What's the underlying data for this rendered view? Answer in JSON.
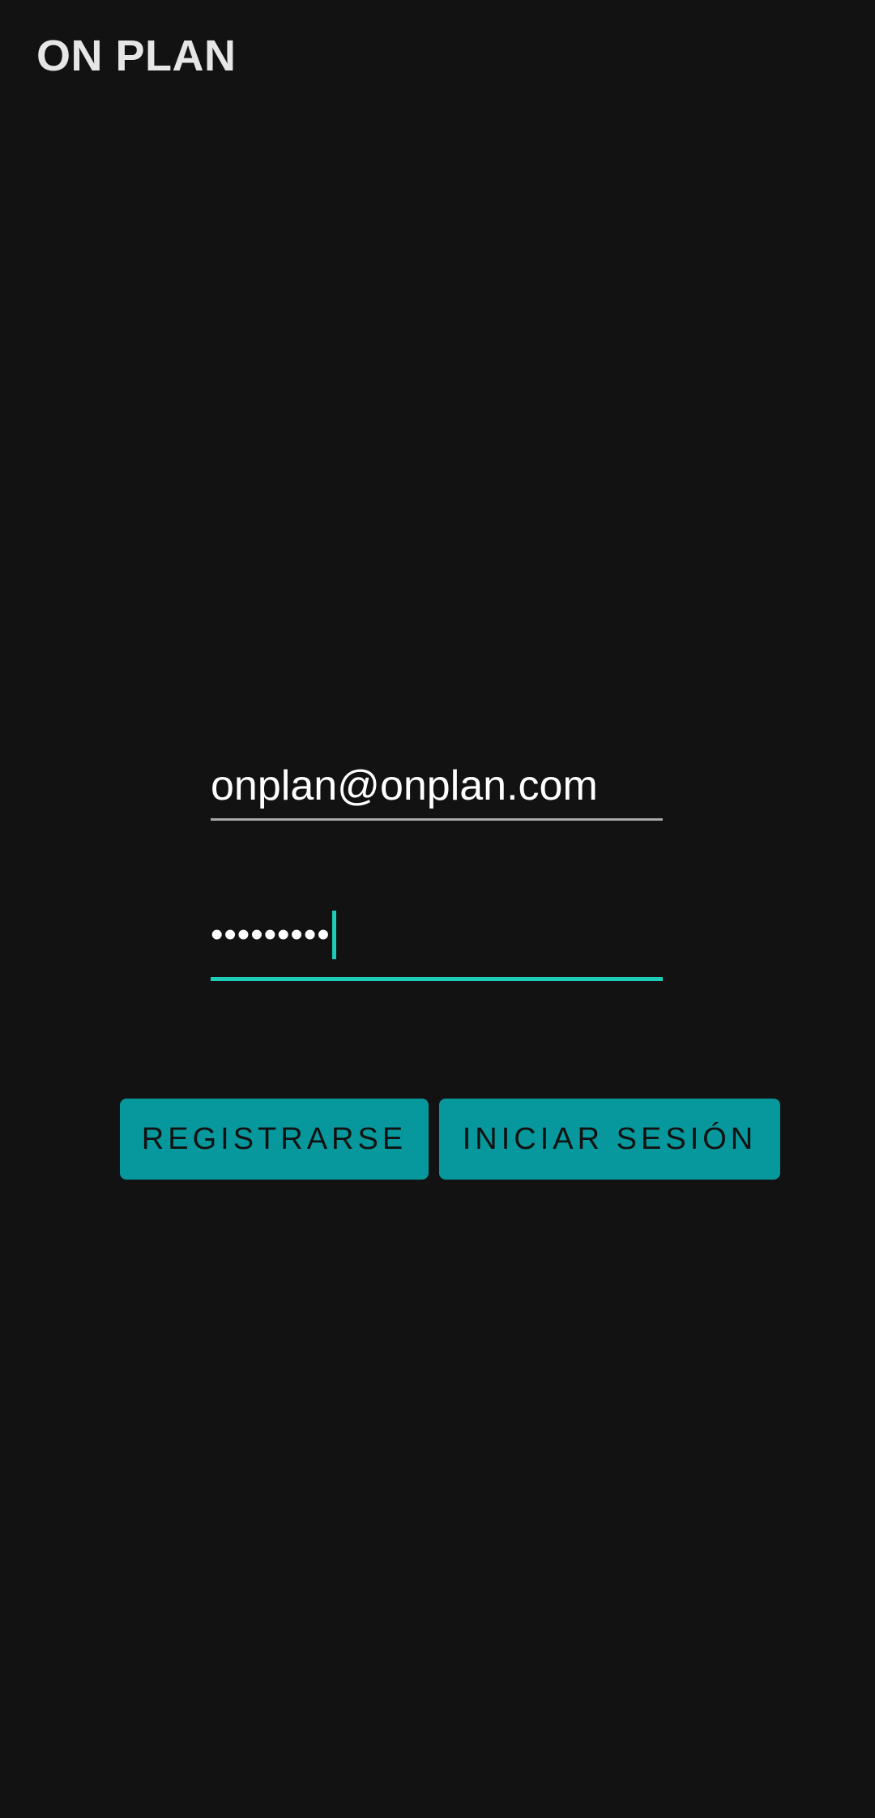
{
  "app_bar": {
    "title": "ON PLAN"
  },
  "login_form": {
    "email": {
      "value": "onplan@onplan.com"
    },
    "password": {
      "masked_value": "•••••••••"
    }
  },
  "actions": {
    "register_label": "REGISTRARSE",
    "login_label": "INICIAR SESIÓN"
  },
  "colors": {
    "background": "#121212",
    "accent": "#1ccbb8",
    "button": "#06989c"
  }
}
